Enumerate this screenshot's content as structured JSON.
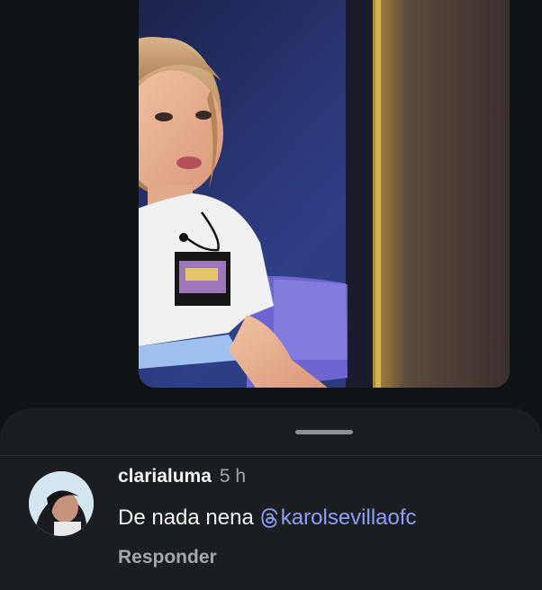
{
  "media": {
    "description_icon": "video-frame"
  },
  "comments_sheet": {
    "comment": {
      "username": "clarialuma",
      "timestamp": "5 h",
      "text": "De nada nena",
      "mention": "karolsevillaofc",
      "mention_icon": "threads-icon",
      "reply_label": "Responder"
    }
  },
  "colors": {
    "background": "#0f1316",
    "sheet": "#1b1e21",
    "mention": "#8f9ef8",
    "secondary_text": "#a3a8ad"
  }
}
